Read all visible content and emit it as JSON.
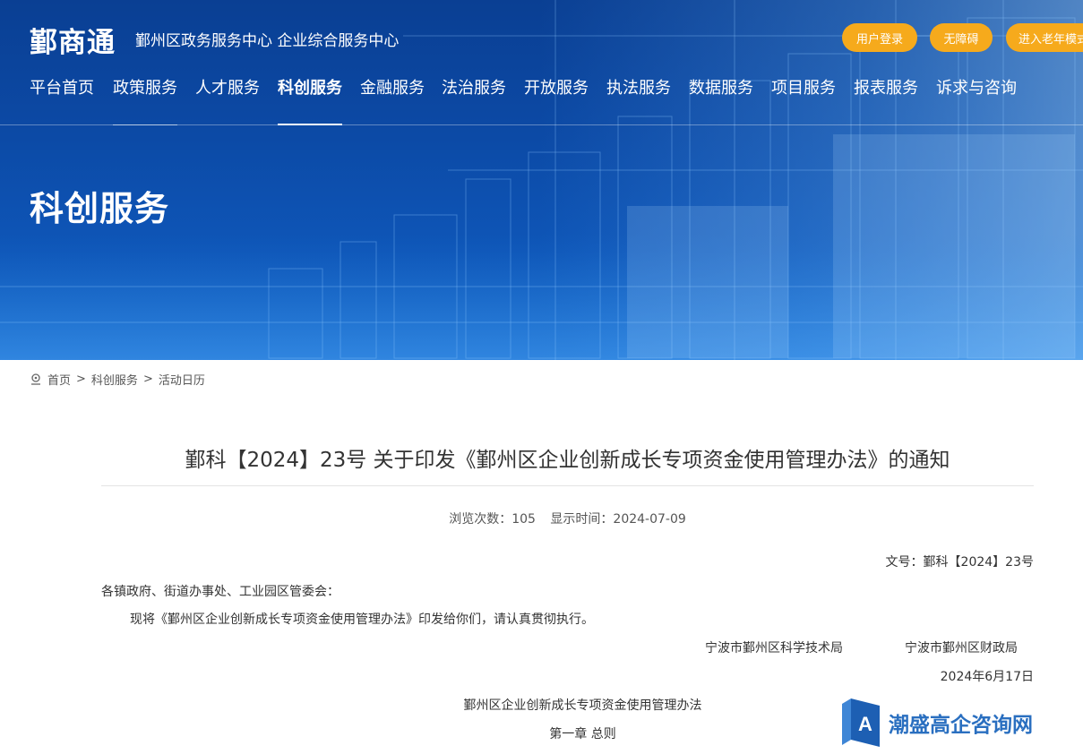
{
  "header": {
    "logo": "鄞商通",
    "subtitle": "鄞州区政务服务中心 企业综合服务中心",
    "buttons": {
      "login": "用户登录",
      "accessibility": "无障碍",
      "elder_mode": "进入老年模式"
    }
  },
  "nav": {
    "items": [
      {
        "label": "平台首页"
      },
      {
        "label": "政策服务"
      },
      {
        "label": "人才服务"
      },
      {
        "label": "科创服务"
      },
      {
        "label": "金融服务"
      },
      {
        "label": "法治服务"
      },
      {
        "label": "开放服务"
      },
      {
        "label": "执法服务"
      },
      {
        "label": "数据服务"
      },
      {
        "label": "项目服务"
      },
      {
        "label": "报表服务"
      },
      {
        "label": "诉求与咨询"
      }
    ],
    "active": "科创服务"
  },
  "banner": {
    "heading": "科创服务"
  },
  "breadcrumb": {
    "icon": "location-icon",
    "items": [
      "首页",
      "科创服务",
      "活动日历"
    ],
    "separator": ">"
  },
  "article": {
    "title": "鄞科【2024】23号 关于印发《鄞州区企业创新成长专项资金使用管理办法》的通知",
    "views_label": "浏览次数：105",
    "date_label": "显示时间：2024-07-09",
    "doc_number": "文号：鄞科【2024】23号",
    "recipients": "各镇政府、街道办事处、工业园区管委会：",
    "body": "现将《鄞州区企业创新成长专项资金使用管理办法》印发给你们，请认真贯彻执行。",
    "issuer_1": "宁波市鄞州区科学技术局",
    "issuer_2": "宁波市鄞州区财政局",
    "issue_date": "2024年6月17日",
    "doc_heading": "鄞州区企业创新成长专项资金使用管理办法",
    "chapter": "第一章 总则"
  },
  "watermark": {
    "text": "潮盛高企咨询网"
  },
  "colors": {
    "banner_top": "#0a3f93",
    "banner_bottom": "#1a6fcf",
    "button": "#f6aa1c",
    "watermark": "#2a6fc0"
  }
}
